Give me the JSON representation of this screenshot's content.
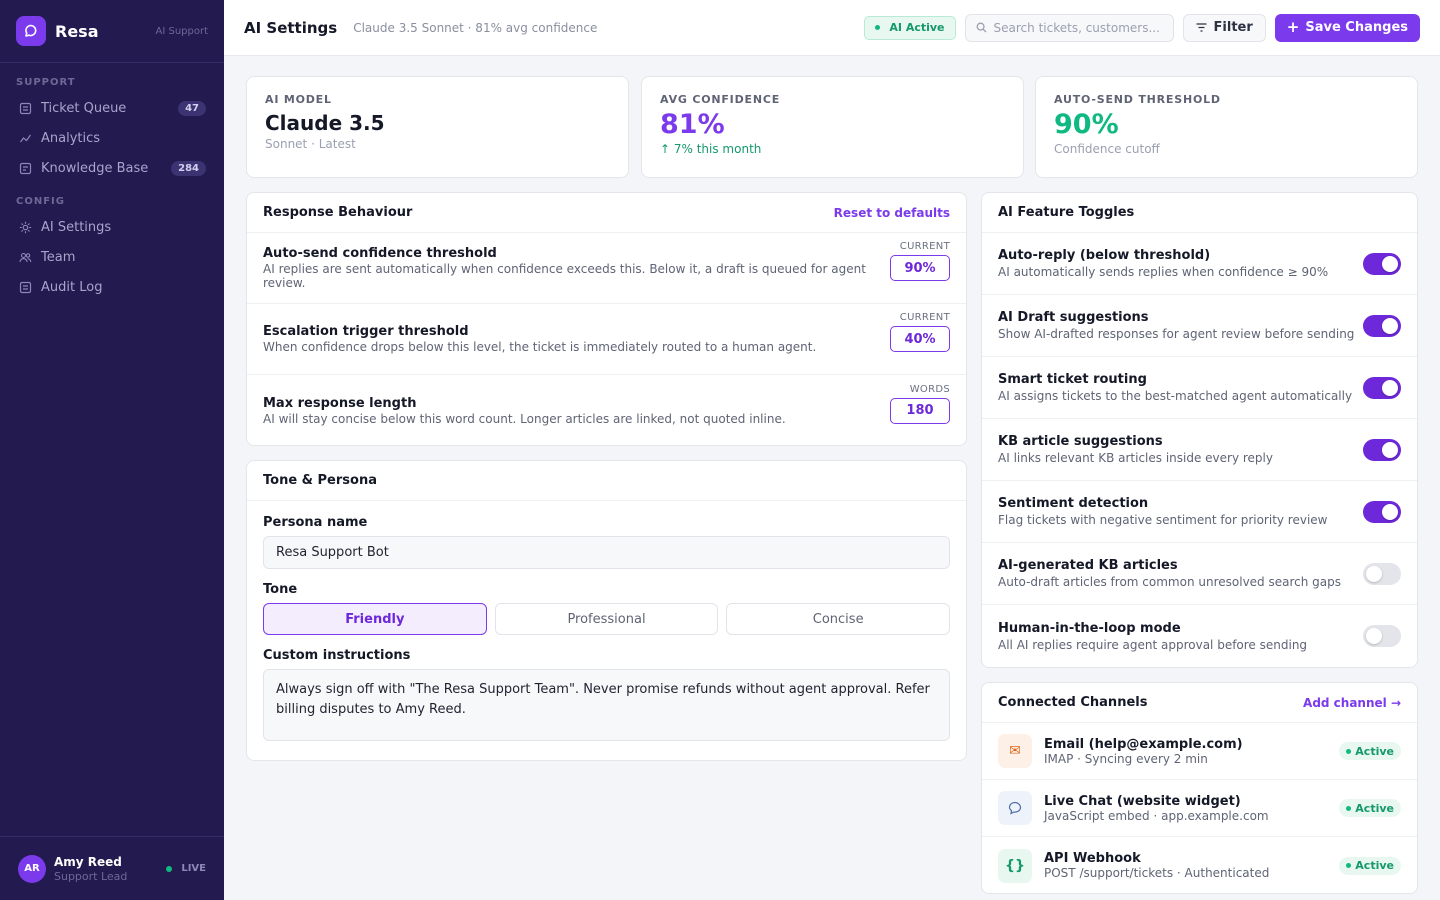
{
  "brand": {
    "name": "Resa",
    "subtitle": "AI Support",
    "logo_icon": "chat-bubble-icon"
  },
  "sidebar": {
    "sections": [
      {
        "label": "SUPPORT",
        "items": [
          {
            "label": "Ticket Queue",
            "icon": "ticket-icon",
            "count": "47"
          },
          {
            "label": "Analytics",
            "icon": "chart-line-icon"
          },
          {
            "label": "Knowledge Base",
            "icon": "book-icon",
            "count": "284"
          }
        ]
      },
      {
        "label": "CONFIG",
        "items": [
          {
            "label": "AI Settings",
            "icon": "gear-icon",
            "active": true
          },
          {
            "label": "Team",
            "icon": "users-icon"
          },
          {
            "label": "Audit Log",
            "icon": "list-icon"
          }
        ]
      }
    ],
    "user": {
      "initials": "AR",
      "name": "Amy Reed",
      "role": "Support Lead",
      "status": "LIVE"
    }
  },
  "header": {
    "title": "AI Settings",
    "subtitle": "Claude 3.5 Sonnet · 81% avg confidence",
    "status_badge": "AI Active",
    "search_placeholder": "Search tickets, customers...",
    "filter_label": "Filter",
    "save_label": "Save Changes"
  },
  "stats": [
    {
      "label": "AI MODEL",
      "value": "Claude 3.5",
      "note": "Sonnet · Latest",
      "color": "#141827"
    },
    {
      "label": "AVG CONFIDENCE",
      "value": "81%",
      "note": "↑ 7% this month",
      "color": "#7c3aed",
      "note_color": "#15996b"
    },
    {
      "label": "AUTO-SEND THRESHOLD",
      "value": "90%",
      "note": "Confidence cutoff",
      "color": "#10b981"
    }
  ],
  "response_behaviour": {
    "title": "Response Behaviour",
    "reset_label": "Reset to defaults",
    "settings": [
      {
        "title": "Auto-send confidence threshold",
        "desc": "AI replies are sent automatically when confidence exceeds this. Below it, a draft is queued for agent review.",
        "value_label": "CURRENT",
        "value": "90%"
      },
      {
        "title": "Escalation trigger threshold",
        "desc": "When confidence drops below this level, the ticket is immediately routed to a human agent.",
        "value_label": "CURRENT",
        "value": "40%"
      },
      {
        "title": "Max response length",
        "desc": "AI will stay concise below this word count. Longer articles are linked, not quoted inline.",
        "value_label": "WORDS",
        "value": "180"
      }
    ]
  },
  "tone_persona": {
    "title": "Tone & Persona",
    "persona_label": "Persona name",
    "persona_value": "Resa Support Bot",
    "tone_label": "Tone",
    "tones": [
      "Friendly",
      "Professional",
      "Concise"
    ],
    "selected_tone": "Friendly",
    "instructions_label": "Custom instructions",
    "instructions_value": "Always sign off with \"The Resa Support Team\". Never promise refunds without agent approval. Refer billing disputes to Amy Reed."
  },
  "feature_toggles": {
    "title": "AI Feature Toggles",
    "items": [
      {
        "title": "Auto-reply (below threshold)",
        "desc": "AI automatically sends replies when confidence ≥ 90%",
        "on": true
      },
      {
        "title": "AI Draft suggestions",
        "desc": "Show AI-drafted responses for agent review before sending",
        "on": true
      },
      {
        "title": "Smart ticket routing",
        "desc": "AI assigns tickets to the best-matched agent automatically",
        "on": true
      },
      {
        "title": "KB article suggestions",
        "desc": "AI links relevant KB articles inside every reply",
        "on": true
      },
      {
        "title": "Sentiment detection",
        "desc": "Flag tickets with negative sentiment for priority review",
        "on": true
      },
      {
        "title": "AI-generated KB articles",
        "desc": "Auto-draft articles from common unresolved search gaps",
        "on": false
      },
      {
        "title": "Human-in-the-loop mode",
        "desc": "All AI replies require agent approval before sending",
        "on": false
      }
    ]
  },
  "channels": {
    "title": "Connected Channels",
    "add_label": "Add channel →",
    "items": [
      {
        "name": "Email (help@example.com)",
        "desc": "IMAP · Syncing every 2 min",
        "status": "Active",
        "icon": "envelope-icon",
        "glyph": "✉",
        "bg": "#fdf1e7",
        "fg": "#e0661b"
      },
      {
        "name": "Live Chat (website widget)",
        "desc": "JavaScript embed · app.example.com",
        "status": "Active",
        "icon": "speech-bubble-icon",
        "glyph": "💬",
        "bg": "#eef3fb",
        "fg": "#4e6fa8"
      },
      {
        "name": "API Webhook",
        "desc": "POST /support/tickets · Authenticated",
        "status": "Active",
        "icon": "code-braces-icon",
        "glyph": "{}",
        "bg": "#e8f8f1",
        "fg": "#15996b"
      }
    ]
  }
}
